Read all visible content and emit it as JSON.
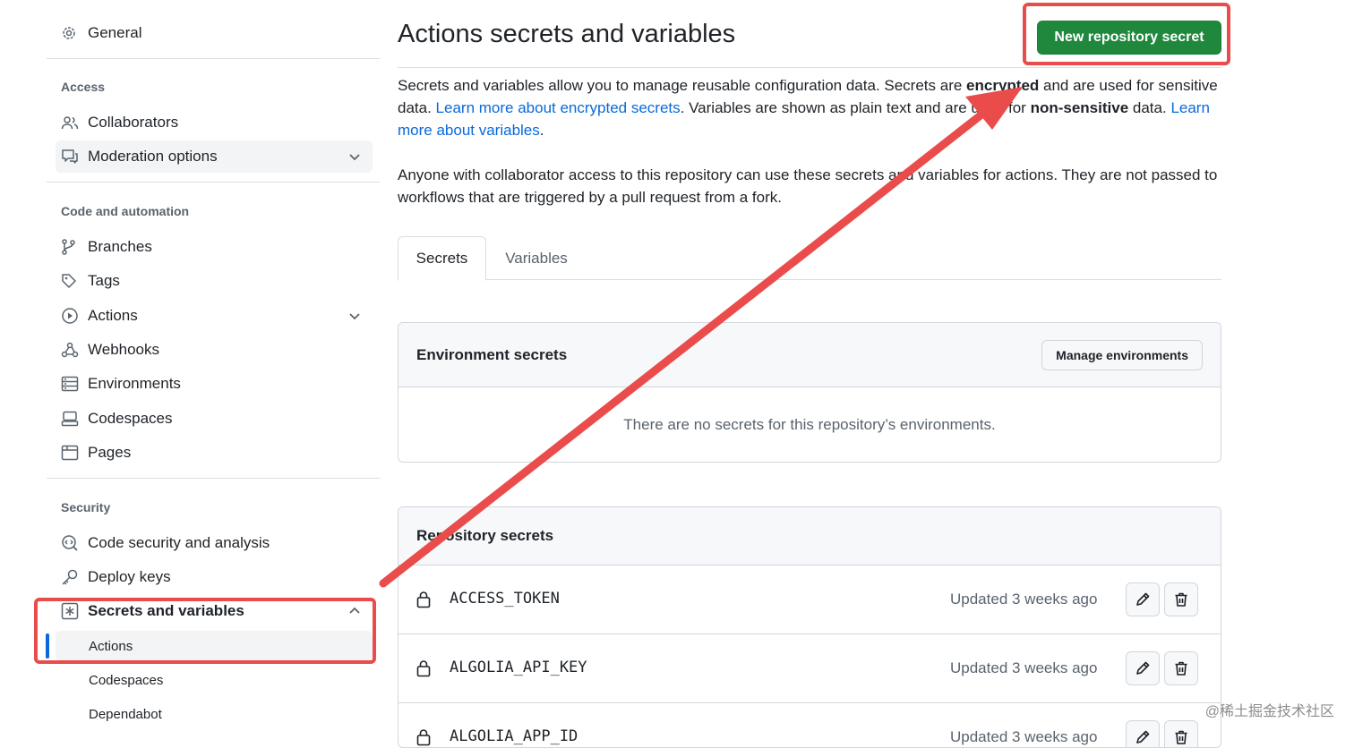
{
  "sidebar": {
    "general": "General",
    "sections": {
      "access": "Access",
      "code_automation": "Code and automation",
      "security": "Security"
    },
    "access_items": [
      "Collaborators",
      "Moderation options"
    ],
    "code_items": [
      "Branches",
      "Tags",
      "Actions",
      "Webhooks",
      "Environments",
      "Codespaces",
      "Pages"
    ],
    "security_items": [
      "Code security and analysis",
      "Deploy keys",
      "Secrets and variables"
    ],
    "secrets_sub_items": [
      "Actions",
      "Codespaces",
      "Dependabot"
    ]
  },
  "main": {
    "title": "Actions secrets and variables",
    "new_secret_button": "New repository secret",
    "intro": {
      "p1_a": "Secrets and variables allow you to manage reusable configuration data. Secrets are ",
      "p1_bold1": "encrypted",
      "p1_b": " and are used for sensitive data. ",
      "p1_link1": "Learn more about encrypted secrets",
      "p1_c": ". Variables are shown as plain text and are used for ",
      "p1_bold2": "non-sensitive",
      "p1_d": " data. ",
      "p1_link2": "Learn more about variables",
      "p1_e": ".",
      "p2": "Anyone with collaborator access to this repository can use these secrets and variables for actions. They are not passed to workflows that are triggered by a pull request from a fork."
    },
    "tabs": [
      "Secrets",
      "Variables"
    ],
    "environment_secrets": {
      "title": "Environment secrets",
      "manage_button": "Manage environments",
      "empty": "There are no secrets for this repository’s environments."
    },
    "repository_secrets": {
      "title": "Repository secrets",
      "rows": [
        {
          "name": "ACCESS_TOKEN",
          "updated": "Updated 3 weeks ago"
        },
        {
          "name": "ALGOLIA_API_KEY",
          "updated": "Updated 3 weeks ago"
        },
        {
          "name": "ALGOLIA_APP_ID",
          "updated": "Updated 3 weeks ago"
        }
      ]
    }
  },
  "watermark": "@稀土掘金技术社区",
  "colors": {
    "accent_blue": "#0969da",
    "primary_green": "#1f883d",
    "annotation_red": "#ea4c4c"
  }
}
